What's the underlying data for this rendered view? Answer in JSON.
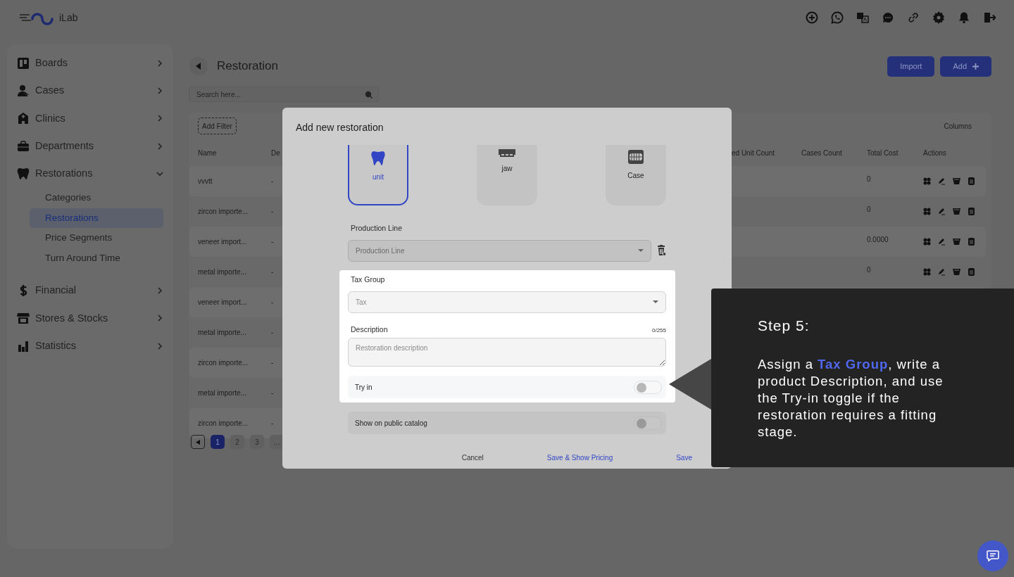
{
  "topbar": {
    "brand": "iLab"
  },
  "sidebar": {
    "items": [
      {
        "label": "Boards",
        "expanded": false
      },
      {
        "label": "Cases",
        "expanded": false
      },
      {
        "label": "Clinics",
        "expanded": false
      },
      {
        "label": "Departments",
        "expanded": false
      },
      {
        "label": "Restorations",
        "expanded": true,
        "children": [
          {
            "label": "Categories",
            "selected": false
          },
          {
            "label": "Restorations",
            "selected": true
          },
          {
            "label": "Price Segments",
            "selected": false
          },
          {
            "label": "Turn Around Time",
            "selected": false
          }
        ]
      },
      {
        "label": "Financial",
        "expanded": false
      },
      {
        "label": "Stores & Stocks",
        "expanded": false
      },
      {
        "label": "Statistics",
        "expanded": false
      }
    ]
  },
  "page": {
    "title": "Restoration",
    "buttons": [
      {
        "label": "Import",
        "kind": "plain"
      },
      {
        "label": "Add",
        "kind": "add"
      }
    ],
    "search": {
      "placeholder": "Search here..."
    },
    "table": {
      "filter_button": "Add Filter",
      "columns_button": "Columns",
      "columns": [
        "Name",
        "De",
        "ed Unit Count",
        "Cases Count",
        "Total Cost",
        "Actions"
      ],
      "rows": [
        {
          "name": "vvvtt",
          "description": "-",
          "total_cost": "0"
        },
        {
          "name": "zircon importe...",
          "description": "-",
          "total_cost": "0"
        },
        {
          "name": "veneer import...",
          "description": "-",
          "total_cost": "0.0000"
        },
        {
          "name": "metal importe...",
          "description": "-",
          "total_cost": "0"
        },
        {
          "name": "veneer import...",
          "description": "-"
        },
        {
          "name": "metal importe...",
          "description": "-"
        },
        {
          "name": "zircon importe...",
          "description": "-"
        },
        {
          "name": "metal importe...",
          "description": "-"
        },
        {
          "name": "zircon importe...",
          "description": "-"
        }
      ]
    },
    "pagination": [
      {
        "label": "1",
        "selected": true
      },
      {
        "label": "2",
        "selected": false
      },
      {
        "label": "3",
        "selected": false
      },
      {
        "label": "...",
        "selected": false
      }
    ]
  },
  "modal": {
    "title": "Add new restoration",
    "types": [
      {
        "label": "unit",
        "selected": true
      },
      {
        "label": "jaw",
        "selected": false
      },
      {
        "label": "Case",
        "selected": false
      }
    ],
    "production_line": {
      "label": "Production Line",
      "placeholder": "Production Line"
    },
    "tax_group": {
      "label": "Tax Group",
      "placeholder": "Tax"
    },
    "description": {
      "label": "Description",
      "counter": "0/255",
      "placeholder": "Restoration description"
    },
    "toggles": [
      {
        "label": "Try in",
        "on": false
      },
      {
        "label": "Show on public catalog",
        "on": false
      }
    ],
    "buttons": [
      {
        "label": "Cancel",
        "kind": "plain"
      },
      {
        "label": "Save & Show Pricing",
        "kind": "link"
      },
      {
        "label": "Save",
        "kind": "link"
      }
    ]
  },
  "tour": {
    "title": "Step 5:",
    "text": "Assign a **Tax Group**, write a product Description, and use the Try-in toggle if the restoration requires a fitting stage."
  }
}
